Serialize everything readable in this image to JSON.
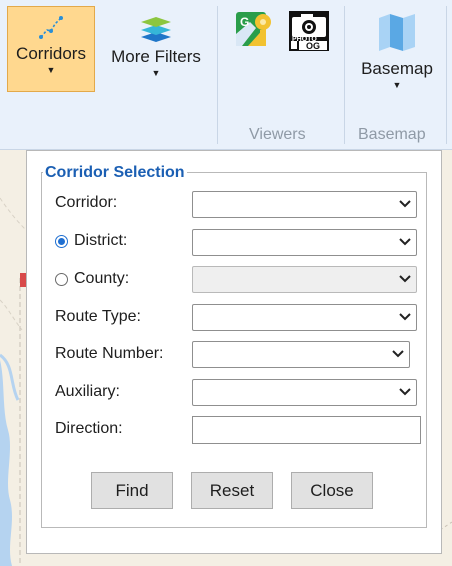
{
  "ribbon": {
    "corridors_label": "Corridors",
    "more_filters_label": "More Filters",
    "basemap_label": "Basemap",
    "groups": {
      "viewers": "Viewers",
      "basemap": "Basemap"
    },
    "icons": {
      "corridors": "corridor-route-icon",
      "more_filters": "layers-icon",
      "google_maps": "google-maps-icon",
      "photolog": "photolog-camera-icon",
      "basemap": "map-icon"
    },
    "photolog_text": {
      "top": "PHOTO",
      "bottom": "OG"
    },
    "google_letter": "G",
    "accent_color": "#ffd88f"
  },
  "panel": {
    "legend": "Corridor Selection",
    "fields": [
      {
        "label": "Corridor:",
        "type": "select",
        "value": ""
      },
      {
        "label": "District:",
        "type": "radio-select",
        "checked": true,
        "value": ""
      },
      {
        "label": "County:",
        "type": "radio-select",
        "checked": false,
        "disabled": true,
        "value": ""
      },
      {
        "label": "Route Type:",
        "type": "select",
        "value": ""
      },
      {
        "label": "Route Number:",
        "type": "select",
        "value": ""
      },
      {
        "label": "Auxiliary:",
        "type": "select",
        "value": ""
      },
      {
        "label": "Direction:",
        "type": "text",
        "value": ""
      }
    ],
    "buttons": {
      "find": "Find",
      "reset": "Reset",
      "close": "Close"
    },
    "legend_color": "#1b5fb3"
  }
}
